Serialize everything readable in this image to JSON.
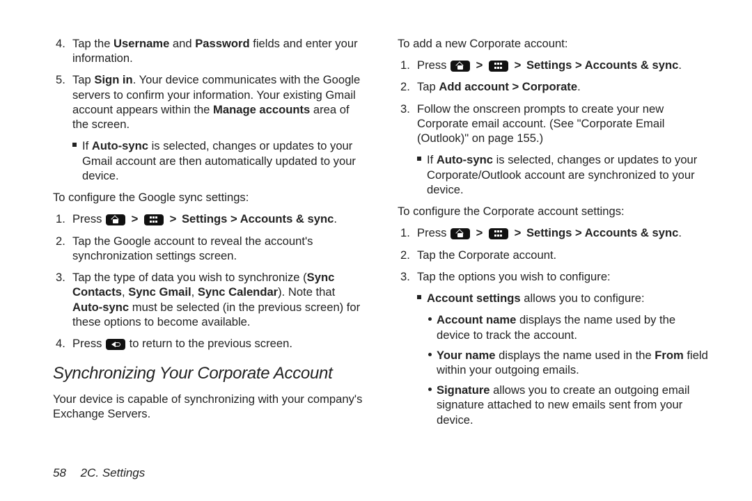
{
  "left": {
    "list4_pre": "Tap the ",
    "list4_b1": "Username",
    "list4_mid": " and ",
    "list4_b2": "Password",
    "list4_post": " fields and enter your information.",
    "list5_pre": "Tap ",
    "list5_b1": "Sign in",
    "list5_mid": ". Your device communicates with the Google servers to confirm your information. Your existing Gmail account appears within the ",
    "list5_b2": "Manage accounts",
    "list5_post": " area of the screen.",
    "list5_sub_pre": "If ",
    "list5_sub_b": "Auto-sync",
    "list5_sub_post": " is selected, changes or updates to your Gmail account are then automatically updated to your device.",
    "lead1": "To configure the Google sync settings:",
    "g1_pre": "Press ",
    "g1_b": "Settings > Accounts & sync",
    "g1_post": ".",
    "g2": "Tap the Google account to reveal the account's synchronization settings screen.",
    "g3_pre": "Tap the type of data you wish to synchronize (",
    "g3_b1": "Sync Contacts",
    "g3_s1": ", ",
    "g3_b2": "Sync Gmail",
    "g3_s2": ", ",
    "g3_b3": "Sync Calendar",
    "g3_mid": "). Note that ",
    "g3_b4": "Auto-sync",
    "g3_post": " must be selected (in the previous screen) for these options to become available.",
    "g4_pre": "Press ",
    "g4_post": " to return to the previous screen.",
    "heading": "Synchronizing Your Corporate Account",
    "intro": "Your device is capable of synchronizing with your company's Exchange Servers."
  },
  "right": {
    "lead1": "To add a new Corporate account:",
    "a1_pre": "Press ",
    "a1_b": "Settings > Accounts & sync",
    "a1_post": ".",
    "a2_pre": "Tap ",
    "a2_b": "Add account > Corporate",
    "a2_post": ".",
    "a3": "Follow the onscreen prompts to create your new Corporate email account. (See \"Corporate Email (Outlook)\" on page 155.)",
    "a3_sub_pre": "If ",
    "a3_sub_b": "Auto-sync",
    "a3_sub_post": " is selected, changes or updates to your Corporate/Outlook account are synchronized to your device.",
    "lead2": "To configure the Corporate account settings:",
    "c1_pre": "Press ",
    "c1_b": "Settings > Accounts & sync",
    "c1_post": ".",
    "c2": "Tap the Corporate account.",
    "c3": "Tap the options you wish to configure:",
    "c3_sub_b": "Account settings",
    "c3_sub_post": " allows you to configure:",
    "ss1_b": "Account name",
    "ss1_post": " displays the name used by the device to track the account.",
    "ss2_b": "Your name",
    "ss2_mid": " displays the name used in the ",
    "ss2_b2": "From",
    "ss2_post": " field within your outgoing emails.",
    "ss3_b": "Signature",
    "ss3_post": " allows you to create an outgoing email signature attached to new emails sent from your device."
  },
  "footer": {
    "page": "58",
    "section": "2C. Settings"
  },
  "arrow": ">"
}
